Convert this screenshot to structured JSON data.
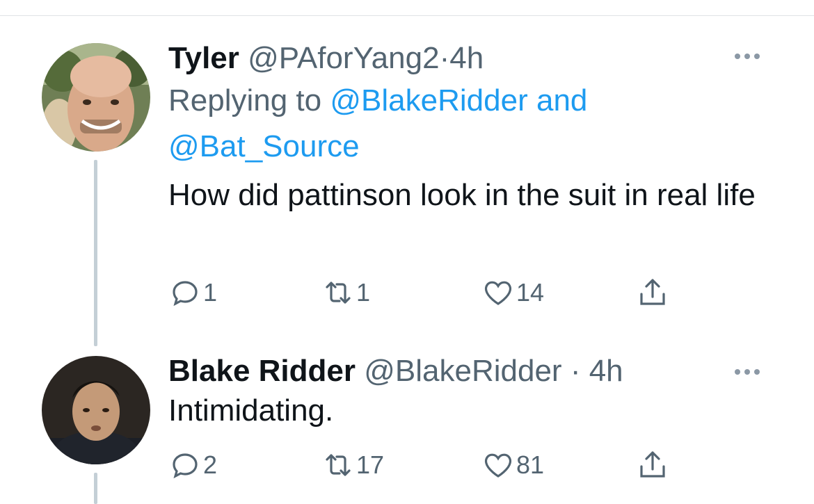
{
  "tweets": [
    {
      "name": "Tyler",
      "handle": "@PAforYang2",
      "separator": "·",
      "time": "4h",
      "replying_prefix": "Replying to",
      "replying_users": [
        "@BlakeRidder",
        "@Bat_Source"
      ],
      "replying_joiner": "and",
      "text": "How did pattinson look in the suit in real life",
      "counts": {
        "reply": "1",
        "retweet": "1",
        "like": "14"
      }
    },
    {
      "name": "Blake Ridder",
      "handle": "@BlakeRidder",
      "separator": "·",
      "time": "4h",
      "text": "Intimidating.",
      "counts": {
        "reply": "2",
        "retweet": "17",
        "like": "81"
      }
    }
  ],
  "icons": {
    "more": "more-horizontal-icon",
    "reply": "reply-bubble-icon",
    "retweet": "retweet-arrows-icon",
    "like": "heart-icon",
    "share": "share-upload-icon"
  },
  "colors": {
    "link": "#1d9bf0",
    "secondary_text": "#536471",
    "thread_line": "#c4cfd6"
  }
}
